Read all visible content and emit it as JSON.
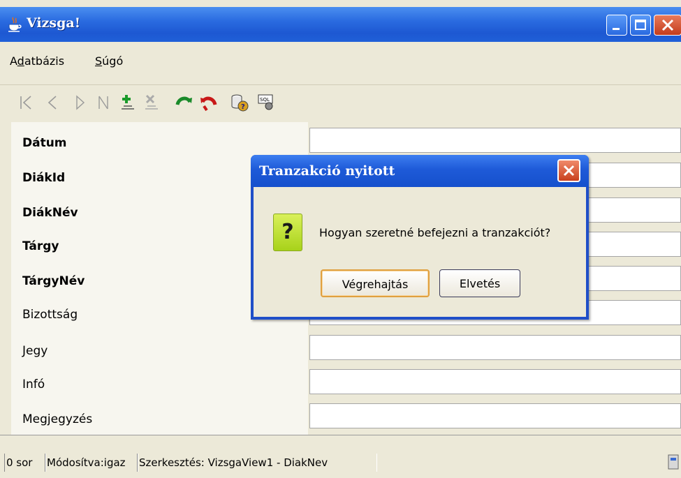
{
  "window": {
    "title": "Vizsga!"
  },
  "menu": {
    "items": [
      {
        "pre": "A",
        "ul": "d",
        "post": "atbázis"
      },
      {
        "pre": "",
        "ul": "S",
        "post": "úgó"
      }
    ]
  },
  "toolbar": {
    "icons": [
      "first-record-icon",
      "prev-record-icon",
      "next-record-icon",
      "last-record-icon",
      "add-record-icon",
      "delete-record-icon",
      "commit-icon",
      "rollback-icon",
      "query-icon",
      "sql-icon"
    ]
  },
  "form": {
    "fields": [
      {
        "label": "Dátum",
        "bold": true
      },
      {
        "label": "DiákId",
        "bold": true
      },
      {
        "label": "DiákNév",
        "bold": true
      },
      {
        "label": "Tárgy",
        "bold": true
      },
      {
        "label": "TárgyNév",
        "bold": true
      },
      {
        "label": "Bizottság",
        "bold": false
      },
      {
        "label": "Jegy",
        "bold": false
      },
      {
        "label": "Infó",
        "bold": false
      },
      {
        "label": "Megjegyzés",
        "bold": false
      }
    ]
  },
  "status": {
    "rows": "0 sor",
    "modified": "Módosítva:igaz",
    "editing": "Szerkesztés: VizsgaView1 - DiakNev"
  },
  "dialog": {
    "title": "Tranzakció nyitott",
    "message": "Hogyan szeretné befejezni a tranzakciót?",
    "icon": "?",
    "commit_label": "Végrehajtás",
    "discard_label": "Elvetés"
  },
  "colors": {
    "titlebar": "#2a6be0",
    "dialog_icon": "#c4e23a",
    "surface": "#ece9d8"
  }
}
